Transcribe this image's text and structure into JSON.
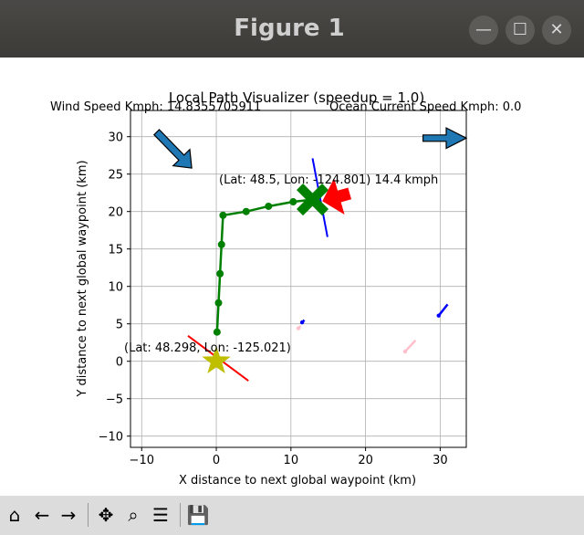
{
  "window": {
    "title": "Figure 1",
    "minimize_glyph": "—",
    "maximize_glyph": "☐",
    "close_glyph": "✕"
  },
  "figure": {
    "wind_text": "Wind Speed Kmph: 14.8355705911",
    "ocean_text": "Ocean Current Speed Kmph: 0.0",
    "boat_label": "(Lat: 48.5, Lon: -124.801) 14.4 kmph",
    "start_label": "(Lat: 48.298, Lon: -125.021)"
  },
  "chart_data": {
    "type": "line",
    "title": "Local Path Visualizer (speedup = 1.0)",
    "xlabel": "X distance to next global waypoint (km)",
    "ylabel": "Y distance to next global waypoint (km)",
    "xlim": [
      -11.5,
      33.5
    ],
    "ylim": [
      -11.5,
      33.5
    ],
    "xticks": [
      -10,
      0,
      10,
      20,
      30
    ],
    "yticks": [
      -10,
      -5,
      0,
      5,
      10,
      15,
      20,
      25,
      30
    ],
    "grid": true,
    "path": {
      "x": [
        0.1,
        0.3,
        0.5,
        0.7,
        0.9,
        4,
        7,
        10.3,
        12.9
      ],
      "y": [
        3.9,
        7.8,
        11.7,
        15.6,
        19.5,
        20.0,
        20.7,
        21.3,
        21.6
      ]
    },
    "boat": {
      "x": 12.9,
      "y": 21.6,
      "heading_line": [
        [
          12.9,
          27.1
        ],
        [
          14.9,
          16.6
        ]
      ]
    },
    "boat_arrow": {
      "from": [
        17.8,
        22.4
      ],
      "to": [
        14.3,
        21.4
      ]
    },
    "start": {
      "x": 0,
      "y": 0
    },
    "start_line": [
      [
        -3.8,
        3.4
      ],
      [
        4.3,
        -2.6
      ]
    ],
    "wind_arrow": {
      "from": [
        -8.0,
        30.6
      ],
      "to": [
        -3.3,
        25.8
      ]
    },
    "ocean_arrow": {
      "from": [
        27.7,
        29.8
      ],
      "to": [
        33.5,
        29.8
      ]
    },
    "obstacles": [
      {
        "x": [
          11.5,
          11.8
        ],
        "y": [
          5.2,
          5.5
        ],
        "color": "#0000ff"
      },
      {
        "x": [
          11.0,
          11.3
        ],
        "y": [
          4.4,
          4.7
        ],
        "color": "#ffc0cb"
      },
      {
        "x": [
          29.8,
          31.0
        ],
        "y": [
          6.1,
          7.6
        ],
        "color": "#0000ff"
      },
      {
        "x": [
          25.3,
          26.7
        ],
        "y": [
          1.3,
          2.8
        ],
        "color": "#ffc0cb"
      }
    ],
    "colors": {
      "path": "#008000",
      "boat_heading": "#0000ff",
      "boat_arrow": "#ff0000",
      "start_marker": "#bfbf00",
      "start_line": "#ff0000",
      "arrow_fill": "#1f77b4"
    }
  },
  "toolbar": {
    "home_icon": "⌂",
    "back_icon": "←",
    "forward_icon": "→",
    "pan_icon": "✥",
    "zoom_icon": "⌕",
    "configure_icon": "☰",
    "save_icon": "💾"
  }
}
